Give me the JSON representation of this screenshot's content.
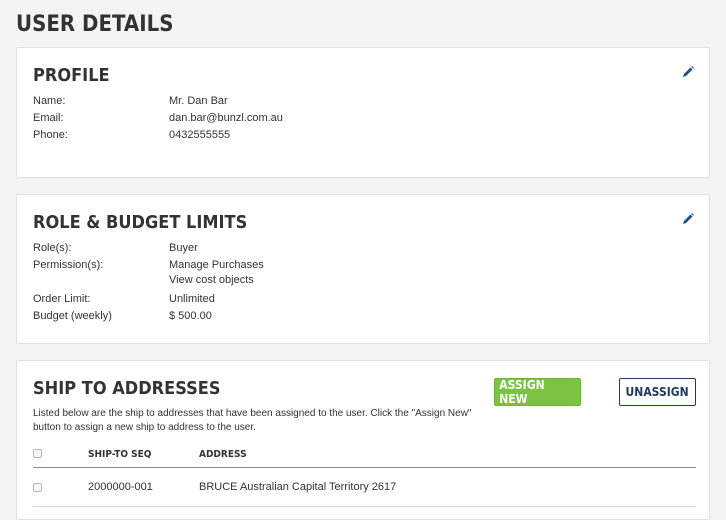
{
  "page": {
    "title": "USER DETAILS"
  },
  "profile": {
    "title": "PROFILE",
    "fields": [
      {
        "label": "Name:",
        "value": "Mr. Dan Bar"
      },
      {
        "label": "Email:",
        "value": "dan.bar@bunzl.com.au"
      },
      {
        "label": "Phone:",
        "value": "0432555555"
      }
    ],
    "edit_icon": "pencil-icon"
  },
  "role": {
    "title": "ROLE & BUDGET LIMITS",
    "roles_label": "Role(s):",
    "roles_value": "Buyer",
    "permissions_label": "Permission(s):",
    "permissions": [
      "Manage Purchases",
      "View cost objects"
    ],
    "order_limit_label": "Order Limit:",
    "order_limit_value": "Unlimited",
    "budget_label": "Budget (weekly)",
    "budget_value": "$ 500.00",
    "edit_icon": "pencil-icon"
  },
  "ship": {
    "title": "SHIP TO ADDRESSES",
    "assign_label": "ASSIGN NEW",
    "unassign_label": "UNASSIGN",
    "description": "Listed below are the ship to addresses that have been assigned to the user. Click the \"Assign New\" button to assign a new ship to address to the user.",
    "columns": [
      "SHIP-TO SEQ",
      "ADDRESS"
    ],
    "rows": [
      {
        "seq": "2000000-001",
        "address": "BRUCE Australian Capital Territory 2617"
      }
    ]
  },
  "colors": {
    "accent_green": "#7cc243",
    "navy": "#1e3a5a",
    "edit_icon": "#1e4f8c"
  }
}
